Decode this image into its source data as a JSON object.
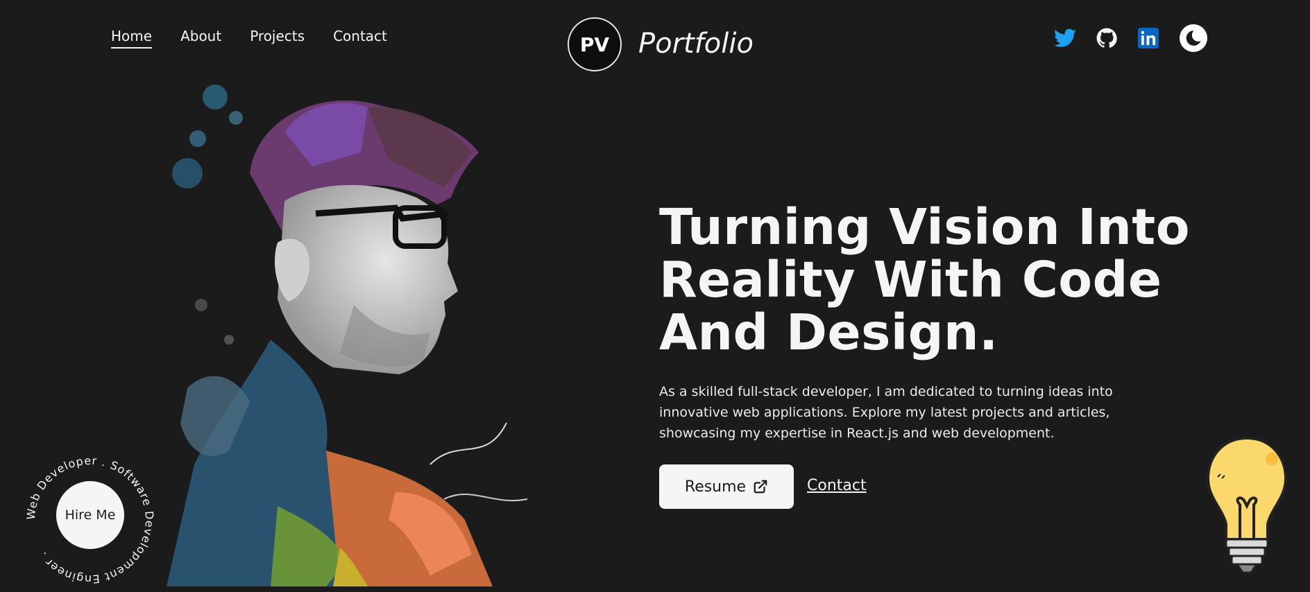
{
  "nav": {
    "items": [
      {
        "label": "Home",
        "active": true
      },
      {
        "label": "About",
        "active": false
      },
      {
        "label": "Projects",
        "active": false
      },
      {
        "label": "Contact",
        "active": false
      }
    ]
  },
  "logo": {
    "initials": "PV",
    "brand": "Portfolio"
  },
  "socials": {
    "icons": [
      "twitter-icon",
      "github-icon",
      "linkedin-icon",
      "theme-toggle-moon-icon"
    ],
    "colors": {
      "twitter": "#1da1f2",
      "linkedin": "#0a66c2"
    }
  },
  "hero": {
    "headline_lines": [
      "Turning Vision Into",
      "Reality With Code",
      "And Design."
    ],
    "intro": "As a skilled full-stack developer, I am dedicated to turning ideas into innovative web applications. Explore my latest projects and articles, showcasing my expertise in React.js and web development.",
    "resume_label": "Resume",
    "contact_label": "Contact"
  },
  "hire": {
    "button_label": "Hire Me",
    "ring_text": "Web Developer . Software Development Engineer ."
  },
  "theme": {
    "background": "#1b1b1b",
    "foreground": "#f5f5f5"
  }
}
